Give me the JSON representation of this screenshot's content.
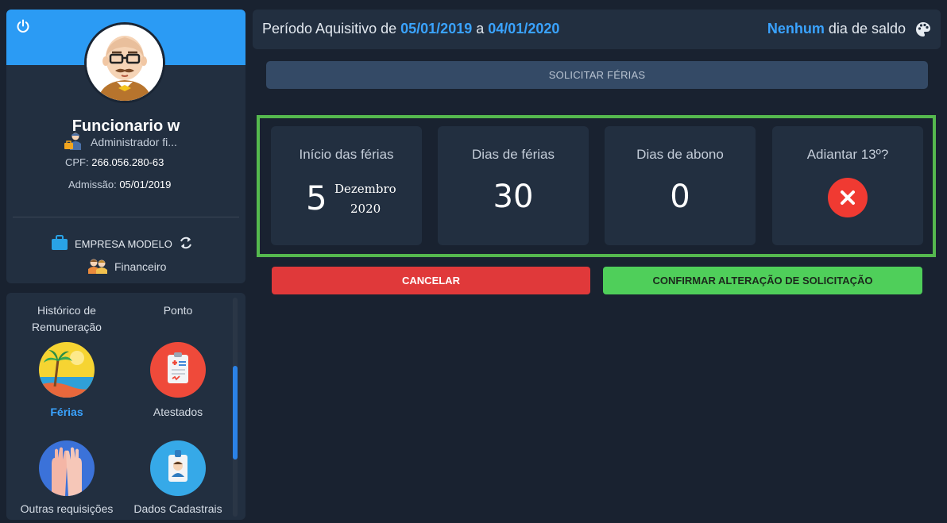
{
  "profile": {
    "name": "Funcionario w",
    "role": "Administrador fi...",
    "cpf_label": "CPF:",
    "cpf_value": "266.056.280-63",
    "admission_label": "Admissão:",
    "admission_value": "05/01/2019",
    "company": "EMPRESA MODELO",
    "department": "Financeiro",
    "banner_color": "#2b9bf4",
    "icons": {
      "power": "power-icon",
      "role": "worker-icon",
      "company": "briefcase-icon",
      "switch": "refresh-icon",
      "department": "team-icon"
    }
  },
  "menu": {
    "items": [
      {
        "label_line1": "Histórico de",
        "label_line2": "Remuneração",
        "icon": "none"
      },
      {
        "label": "Ponto",
        "icon": "none"
      },
      {
        "label": "Férias",
        "icon": "beach-icon",
        "active": true
      },
      {
        "label": "Atestados",
        "icon": "clipboard-icon"
      },
      {
        "label": "Outras requisições",
        "icon": "raised-hands-icon"
      },
      {
        "label": "Dados Cadastrais",
        "icon": "id-badge-icon"
      }
    ]
  },
  "period": {
    "prefix": "Período Aquisitivo de",
    "start": "05/01/2019",
    "connector": "a",
    "end": "04/01/2020",
    "balance_highlight": "Nenhum",
    "balance_suffix": "dia de saldo",
    "palette_icon": "palette-icon"
  },
  "actions": {
    "solicit": "SOLICITAR FÉRIAS",
    "cancel": "CANCELAR",
    "confirm": "CONFIRMAR ALTERAÇÃO DE SOLICITAÇÃO"
  },
  "cards": {
    "start": {
      "title": "Início das férias",
      "day": "5",
      "month": "Dezembro",
      "year": "2020"
    },
    "days": {
      "title": "Dias de férias",
      "value": "30"
    },
    "abono": {
      "title": "Dias de abono",
      "value": "0"
    },
    "advance": {
      "title": "Adiantar 13º?",
      "state": "no",
      "icon": "close-circle-icon"
    }
  },
  "colors": {
    "accent": "#3aa3ff",
    "highlight_frame": "#55b94e",
    "cancel": "#e0393a",
    "confirm": "#4fcf5a",
    "toggle_off": "#f03a32"
  }
}
